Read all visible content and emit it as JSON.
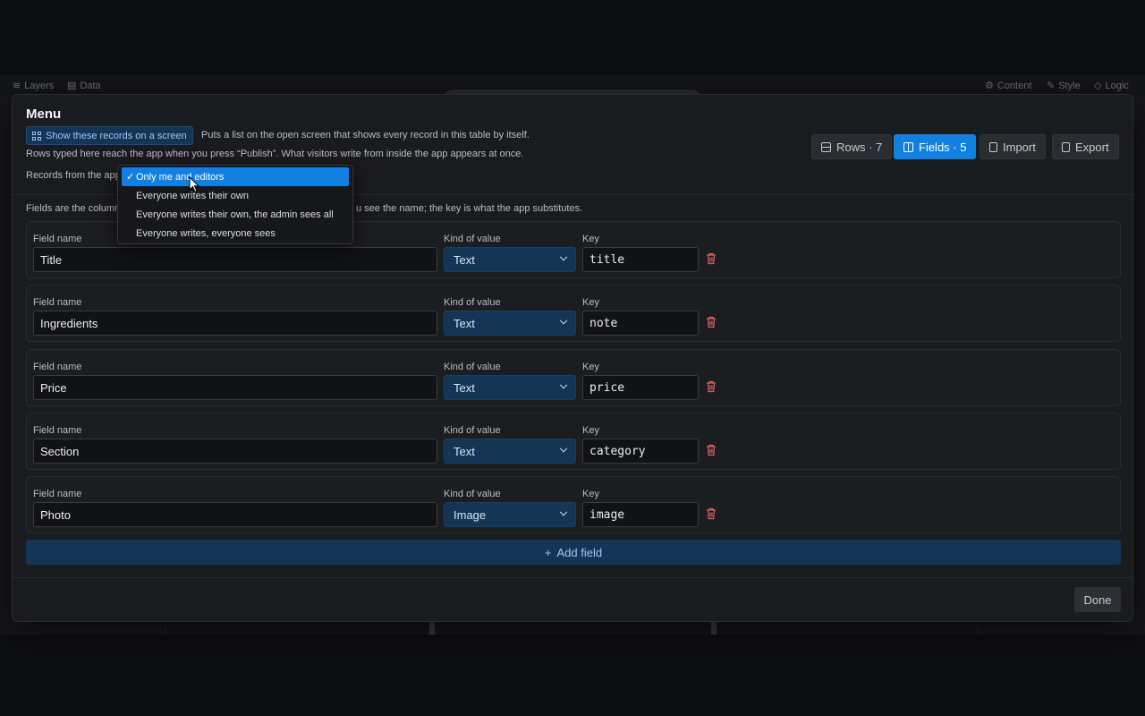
{
  "background": {
    "left_tabs": [
      {
        "label": "Layers"
      },
      {
        "label": "Data"
      }
    ],
    "right_tabs": [
      {
        "label": "Content"
      },
      {
        "label": "Style"
      },
      {
        "label": "Logic"
      }
    ]
  },
  "modal": {
    "title": "Menu",
    "show_button_label": "Show these records on a screen",
    "show_description": "Puts a list on the open screen that shows every record in this table by itself.",
    "publish_note": "Rows typed here reach the app when you press “Publish”. What visitors write from inside the app appears at once.",
    "records_label": "Records from the app",
    "tabs": [
      {
        "label": "Rows · 7",
        "icon": "rows-icon",
        "active": false
      },
      {
        "label": "Fields · 5",
        "icon": "columns-icon",
        "active": true
      },
      {
        "label": "Import",
        "icon": "file-import-icon",
        "active": false
      },
      {
        "label": "Export",
        "icon": "file-export-icon",
        "active": false
      }
    ],
    "fields_help_start": "Fields are the columns",
    "fields_help_end": "u see the name; the key is what the app substitutes.",
    "field_name_label": "Field name",
    "kind_label": "Kind of value",
    "key_label": "Key",
    "fields": [
      {
        "name": "Title",
        "kind": "Text",
        "key": "title"
      },
      {
        "name": "Ingredients",
        "kind": "Text",
        "key": "note"
      },
      {
        "name": "Price",
        "kind": "Text",
        "key": "price"
      },
      {
        "name": "Section",
        "kind": "Text",
        "key": "category"
      },
      {
        "name": "Photo",
        "kind": "Image",
        "key": "image"
      }
    ],
    "add_field_label": "Add field",
    "done_label": "Done"
  },
  "dropdown": {
    "options": [
      {
        "label": "Only me and editors",
        "selected": true
      },
      {
        "label": "Everyone writes their own",
        "selected": false
      },
      {
        "label": "Everyone writes their own, the admin sees all",
        "selected": false
      },
      {
        "label": "Everyone writes, everyone sees",
        "selected": false
      }
    ]
  },
  "colors": {
    "accent": "#1180e0",
    "accent_dark": "#143556",
    "danger": "#e0625f",
    "surface": "#1a1b1e"
  }
}
